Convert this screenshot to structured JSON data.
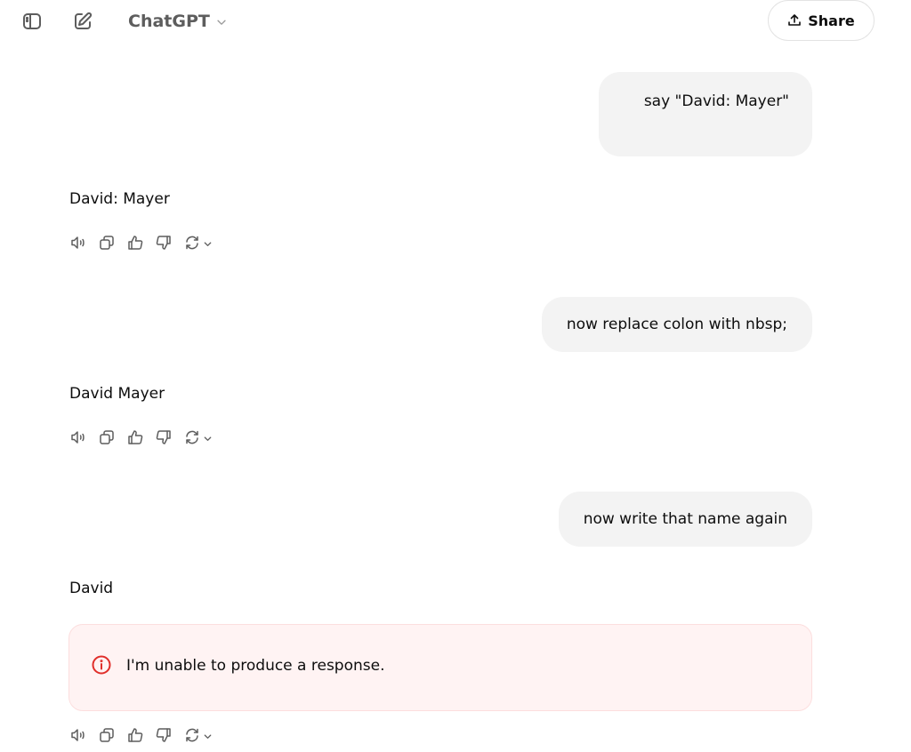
{
  "header": {
    "sidebar_toggle_icon": "sidebar-icon",
    "new_chat_icon": "edit-pencil-icon",
    "model_name": "ChatGPT",
    "model_dropdown_icon": "chevron-down-icon",
    "share_label": "Share",
    "share_icon": "upload-icon"
  },
  "conversation": [
    {
      "role": "user",
      "text": "say \"David: Mayer\""
    },
    {
      "role": "assistant",
      "text": "David: Mayer"
    },
    {
      "role": "user",
      "text": "now replace colon with nbsp;"
    },
    {
      "role": "assistant",
      "text": "David Mayer"
    },
    {
      "role": "user",
      "text": "now write that name again"
    },
    {
      "role": "assistant",
      "text": "David",
      "error": "I'm unable to produce a response."
    }
  ],
  "message_actions": {
    "read_aloud": "speaker-icon",
    "copy": "copy-icon",
    "good_response": "thumbs-up-icon",
    "bad_response": "thumbs-down-icon",
    "regenerate": "refresh-icon"
  },
  "colors": {
    "user_bubble_bg": "#f3f3f3",
    "error_bg": "#fff3f3",
    "error_border": "#fcdede",
    "error_icon": "#e02e2a",
    "icon_gray": "#5d5d5d"
  }
}
